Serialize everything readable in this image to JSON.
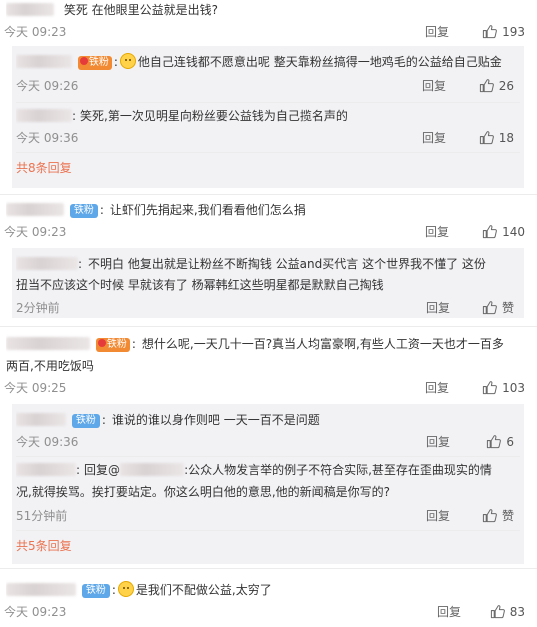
{
  "comments": [
    {
      "text": "笑死 在他眼里公益就是出钱?",
      "time": "今天 09:23",
      "reply": "回复",
      "likes": "193",
      "replies": [
        {
          "text": "他自己连钱都不愿意出呢 整天靠粉丝搞得一地鸡毛的公益给自己贴金",
          "time": "今天 09:26",
          "reply": "回复",
          "likes": "26"
        },
        {
          "text": "笑死,第一次见明星向粉丝要公益钱为自己揽名声的",
          "time": "今天 09:36",
          "reply": "回复",
          "likes": "18"
        }
      ],
      "more": "共8条回复"
    },
    {
      "badge": "铁粉",
      "text": "让虾们先捐起来,我们看看他们怎么捐",
      "time": "今天 09:23",
      "reply": "回复",
      "likes": "140",
      "replies": [
        {
          "text_line1": "不明白 他复出就是让粉丝不断掏钱 公益and买代言  这个世界我不懂了  这份",
          "text_line2": "扭当不应该这个时候 早就该有了 杨幂韩红这些明星都是默默自己掏钱",
          "time": "2分钟前",
          "reply": "回复",
          "likes": "赞"
        }
      ]
    },
    {
      "text_line1": "想什么呢,一天几十一百?真当人均富豪啊,有些人工资一天也才一百多",
      "text_line2": "两百,不用吃饭吗",
      "time": "今天 09:25",
      "reply": "回复",
      "likes": "103",
      "replies": [
        {
          "badge": "铁粉",
          "text": "谁说的谁以身作则吧 一天一百不是问题",
          "time": "今天 09:36",
          "reply": "回复",
          "likes": "6"
        },
        {
          "text_prefix": "回复@",
          "text_line1": ":公众人物发言举的例子不符合实际,甚至存在歪曲现实的情",
          "text_line2": "况,就得挨骂。挨打要站定。你这么明白他的意思,他的新闻稿是你写的?",
          "time": "51分钟前",
          "reply": "回复",
          "likes": "赞"
        }
      ],
      "more": "共5条回复"
    },
    {
      "badge": "铁粉",
      "text": "是我们不配做公益,太穷了",
      "time": "今天 09:23",
      "reply": "回复",
      "likes": "83"
    }
  ],
  "badges": {
    "fan": "铁粉"
  },
  "colors": {
    "badge_blue": "#5ea7e8",
    "link_orange": "#eb7350",
    "reply_bg": "#f2f2f5"
  }
}
